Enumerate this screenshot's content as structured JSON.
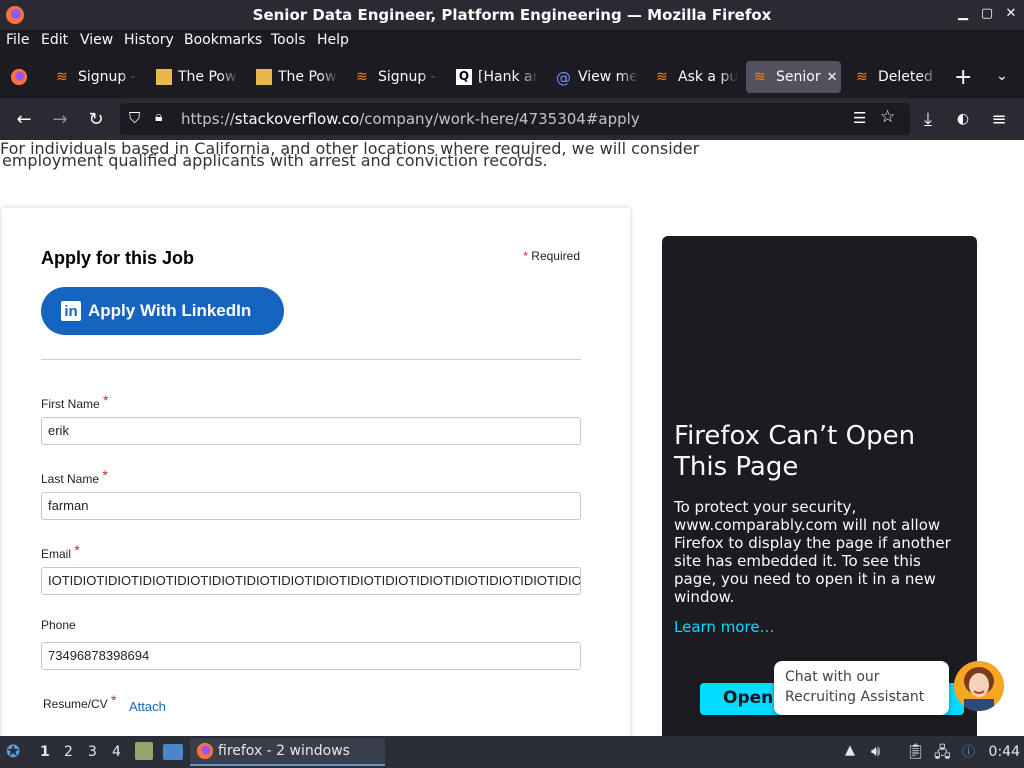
{
  "window": {
    "title": "Senior Data Engineer, Platform Engineering — Mozilla Firefox"
  },
  "menu": [
    "File",
    "Edit",
    "View",
    "History",
    "Bookmarks",
    "Tools",
    "Help"
  ],
  "tabs": [
    {
      "label": "Signup -",
      "icon": "stackoverflow-icon"
    },
    {
      "label": "The Pow",
      "icon": "image-icon"
    },
    {
      "label": "The Pow",
      "icon": "image-icon"
    },
    {
      "label": "Signup -",
      "icon": "stackoverflow-icon"
    },
    {
      "label": "[Hank ar",
      "icon": "q-icon"
    },
    {
      "label": "View me",
      "icon": "at-icon"
    },
    {
      "label": "Ask a pu",
      "icon": "stackoverflow-icon"
    },
    {
      "label": "Senior",
      "icon": "stackoverflow-icon",
      "active": true
    },
    {
      "label": "Deleted",
      "icon": "stackoverflow-icon"
    }
  ],
  "url": {
    "prefix": "https://",
    "domain": "stackoverflow.co",
    "path": "/company/work-here/4735304#apply"
  },
  "page": {
    "intro_cut": "For individuals based in California, and other locations where required, we will consider",
    "intro": "employment qualified applicants with arrest and conviction records."
  },
  "form": {
    "title": "Apply for this Job",
    "required_note": "Required",
    "linkedin_label": "Apply With LinkedIn",
    "first_name_label": "First Name",
    "first_name_value": "erik",
    "last_name_label": "Last Name",
    "last_name_value": "farman",
    "email_label": "Email",
    "email_value": "IOTIDIOTIDIOTIDIOTIDIOTIDIOTIDIOTIDIOTIDIOTIDIOTIDIOTIDIOTIDIOTIDIOTIDIOTIDIOTIDIOTIDIOT",
    "phone_label": "Phone",
    "phone_value": "73496878398694",
    "resume_label": "Resume/CV",
    "attach_label": "Attach"
  },
  "blocked": {
    "title": "Firefox Can’t Open This Page",
    "body": "To protect your security, www.comparably.com will not allow Firefox to display the page if another site has embedded it. To see this page, you need to open it in a new window.",
    "learn_more": "Learn more…",
    "open_button": "Open"
  },
  "chat": {
    "text": "Chat with our Recruiting Assistant"
  },
  "taskbar": {
    "workspaces": [
      "1",
      "2",
      "3",
      "4"
    ],
    "task_label": "firefox - 2 windows",
    "clock": "0:44"
  },
  "colors": {
    "accent": "#00ddff",
    "linkedin": "#1565c0",
    "required": "#e31c1c"
  }
}
